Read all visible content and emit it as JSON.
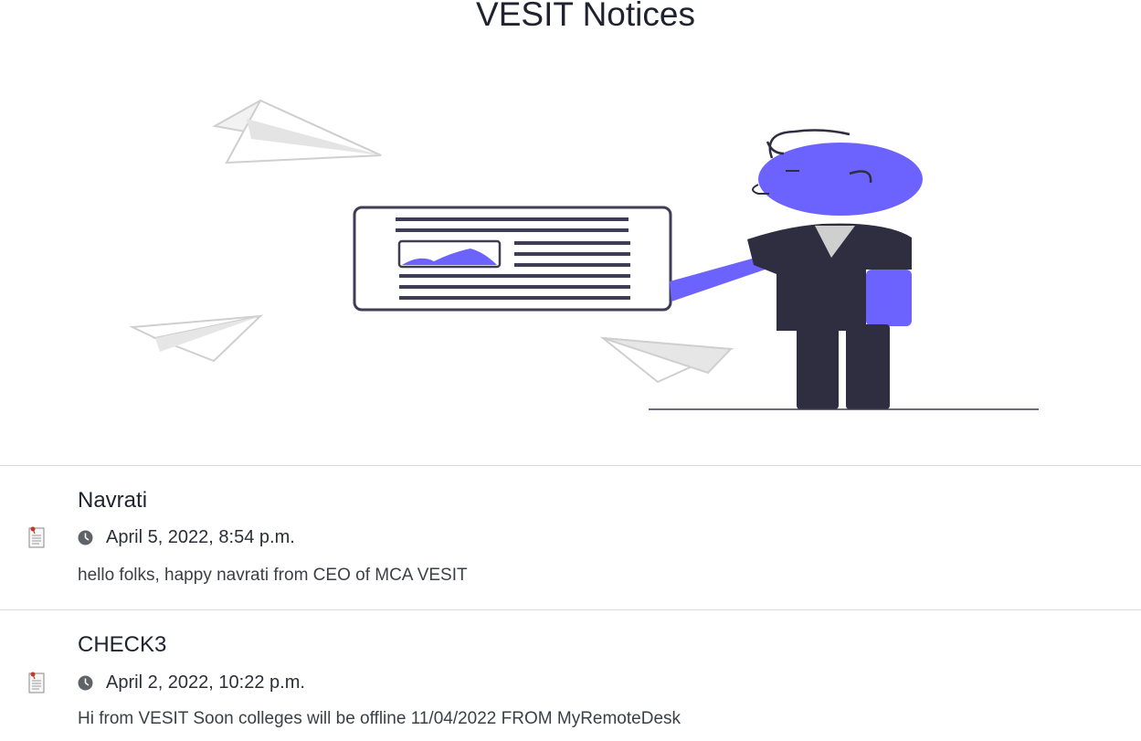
{
  "page": {
    "title": "VESIT Notices"
  },
  "hero": {
    "illustration": "person-presenting-notice-board",
    "accent_color": "#6c63ff",
    "dark_color": "#2f2e41"
  },
  "notices": [
    {
      "icon": "document-pin-icon",
      "title": "Navrati",
      "timestamp_icon": "clock-icon",
      "timestamp": "April 5, 2022, 8:54 p.m.",
      "body": "hello folks, happy navrati from CEO of MCA VESIT"
    },
    {
      "icon": "document-pin-icon",
      "title": "CHECK3",
      "timestamp_icon": "clock-icon",
      "timestamp": "April 2, 2022, 10:22 p.m.",
      "body": "Hi from VESIT Soon colleges will be offline 11/04/2022 FROM MyRemoteDesk"
    }
  ]
}
